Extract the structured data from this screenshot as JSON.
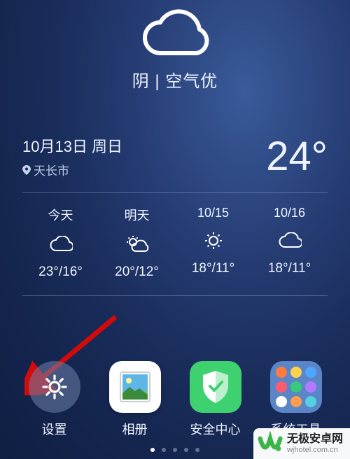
{
  "weather": {
    "condition": "阴",
    "separator": " | ",
    "air_quality": "空气优",
    "date_line": "10月13日 周日",
    "location": "天长市",
    "current_temp": "24°",
    "forecast": [
      {
        "day": "今天",
        "icon": "cloud",
        "temps": "23°/16°"
      },
      {
        "day": "明天",
        "icon": "partly-sun",
        "temps": "20°/12°"
      },
      {
        "day": "10/15",
        "icon": "sun",
        "temps": "18°/11°"
      },
      {
        "day": "10/16",
        "icon": "cloud",
        "temps": "18°/11°"
      }
    ]
  },
  "dock": {
    "apps": [
      {
        "name": "settings",
        "label": "设置"
      },
      {
        "name": "gallery",
        "label": "相册"
      },
      {
        "name": "security",
        "label": "安全中心"
      },
      {
        "name": "tools",
        "label": "系统工具"
      }
    ]
  },
  "colors": {
    "gallery_bg": "#ffffff",
    "gallery_photo_sky": "#5fb6e6",
    "gallery_photo_ground": "#7bc26a",
    "security_bg": "#3ed16f",
    "tools_bg": "#5a86c8",
    "tool_dot_1": "#ff7a3d",
    "tool_dot_2": "#ffd24d",
    "tool_dot_3": "#4da6ff",
    "tool_dot_4": "#ff5a6e",
    "tool_dot_5": "#38c97a",
    "tool_dot_6": "#b478ff",
    "tool_dot_7": "#ffffff",
    "tool_dot_8": "#ff9d4d",
    "tool_dot_9": "#55d0e0",
    "settings_bg": "rgba(110,130,170,0.55)",
    "arrow": "#d20a0a",
    "wm_logo_green": "#3bb54a"
  },
  "watermark": {
    "title": "无极安卓网",
    "url": "wjhotel.com.cn"
  }
}
